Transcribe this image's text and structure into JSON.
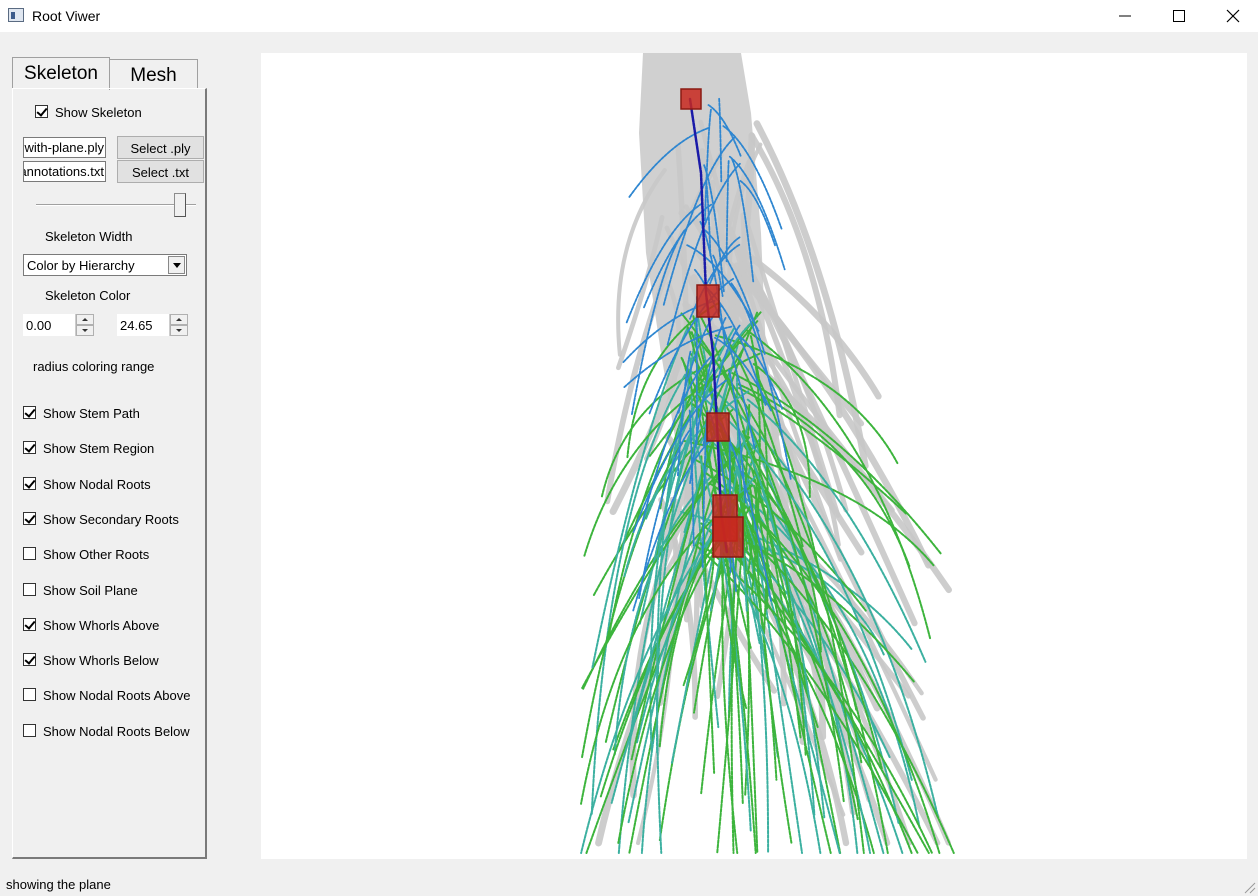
{
  "window": {
    "title": "Root Viwer",
    "controls": {
      "minimize": "minimize-icon",
      "maximize": "maximize-icon",
      "close": "close-icon"
    }
  },
  "tabs": [
    {
      "label": "Skeleton",
      "active": true
    },
    {
      "label": "Mesh",
      "active": false
    }
  ],
  "skeleton_panel": {
    "show_skeleton": {
      "label": "Show Skeleton",
      "checked": true
    },
    "ply_file": {
      "value": "with-plane.ply",
      "button": "Select .ply"
    },
    "txt_file": {
      "value": "annotations.txt",
      "button": "Select .txt"
    },
    "width_slider": {
      "label": "Skeleton Width",
      "value": 0.9
    },
    "color_mode": {
      "selected": "Color by Hierarchy",
      "label": "Skeleton Color"
    },
    "radius_range": {
      "min": "0.00",
      "max": "24.65",
      "label": "radius coloring range"
    },
    "toggles": [
      {
        "label": "Show Stem Path",
        "checked": true
      },
      {
        "label": "Show Stem Region",
        "checked": true
      },
      {
        "label": "Show Nodal Roots",
        "checked": true
      },
      {
        "label": "Show Secondary Roots",
        "checked": true
      },
      {
        "label": "Show Other Roots",
        "checked": false
      },
      {
        "label": "Show Soil Plane",
        "checked": false
      },
      {
        "label": "Show Whorls Above",
        "checked": true
      },
      {
        "label": "Show Whorls Below",
        "checked": true
      },
      {
        "label": "Show Nodal Roots Above",
        "checked": false
      },
      {
        "label": "Show Nodal Roots Below",
        "checked": false
      }
    ]
  },
  "viewport": {
    "description_colors": {
      "mesh": "#c8c8c8",
      "stem_path": "#1a1aa8",
      "nodal_roots": "#2e86d0",
      "secondary_roots": "#3cb43c",
      "whorl_boxes": "#c8281e"
    }
  },
  "status_bar": {
    "text": "showing the plane"
  }
}
